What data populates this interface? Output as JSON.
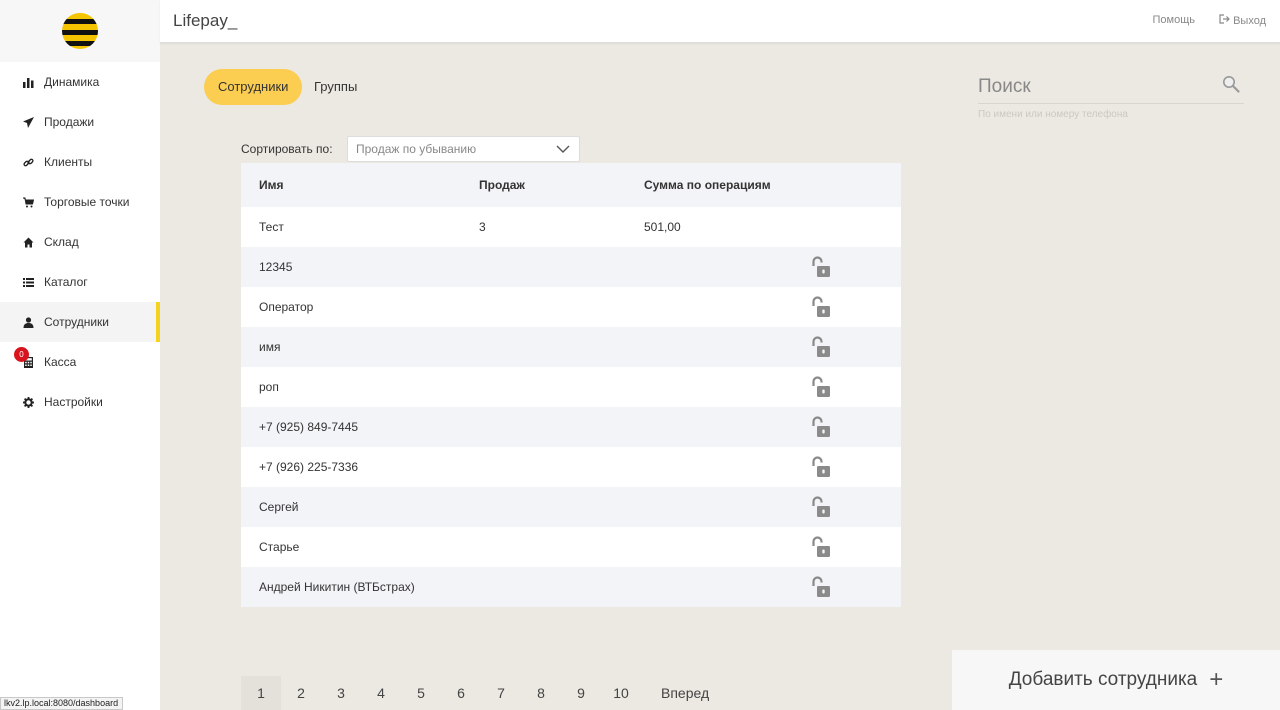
{
  "header": {
    "app_title": "Lifepay_",
    "help": "Помощь",
    "logout": "Выход"
  },
  "sidebar": {
    "items": [
      {
        "label": "Динамика",
        "icon": "bar-chart-icon"
      },
      {
        "label": "Продажи",
        "icon": "paper-plane-icon"
      },
      {
        "label": "Клиенты",
        "icon": "link-icon"
      },
      {
        "label": "Торговые точки",
        "icon": "cart-icon"
      },
      {
        "label": "Склад",
        "icon": "home-icon"
      },
      {
        "label": "Каталог",
        "icon": "list-icon"
      },
      {
        "label": "Сотрудники",
        "icon": "user-icon"
      },
      {
        "label": "Касса",
        "icon": "calculator-icon",
        "badge": "0"
      },
      {
        "label": "Настройки",
        "icon": "gear-icon"
      }
    ],
    "active_index": 6
  },
  "tabs": {
    "employees": "Сотрудники",
    "groups": "Группы"
  },
  "sort": {
    "label": "Сортировать по:",
    "value": "Продаж по убыванию"
  },
  "table": {
    "columns": [
      "Имя",
      "Продаж",
      "Сумма по операциям"
    ],
    "rows": [
      {
        "name": "Тест",
        "sales": "3",
        "sum": "501,00",
        "locked": false
      },
      {
        "name": "12345",
        "sales": "",
        "sum": "",
        "locked": true
      },
      {
        "name": "Оператор",
        "sales": "",
        "sum": "",
        "locked": true
      },
      {
        "name": "имя",
        "sales": "",
        "sum": "",
        "locked": true
      },
      {
        "name": "роп",
        "sales": "",
        "sum": "",
        "locked": true
      },
      {
        "name": "+7 (925) 849-7445",
        "sales": "",
        "sum": "",
        "locked": true
      },
      {
        "name": "+7 (926) 225-7336",
        "sales": "",
        "sum": "",
        "locked": true
      },
      {
        "name": "Сергей",
        "sales": "",
        "sum": "",
        "locked": true
      },
      {
        "name": "Старье",
        "sales": "",
        "sum": "",
        "locked": true
      },
      {
        "name": "Андрей Никитин (ВТБстрах)",
        "sales": "",
        "sum": "",
        "locked": true
      }
    ]
  },
  "search": {
    "placeholder": "Поиск",
    "hint": "По имени или номеру телефона"
  },
  "pagination": {
    "pages": [
      "1",
      "2",
      "3",
      "4",
      "5",
      "6",
      "7",
      "8",
      "9",
      "10"
    ],
    "current": "1",
    "next": "Вперед"
  },
  "add_employee": {
    "label": "Добавить сотрудника",
    "plus": "+"
  },
  "statusbar": {
    "url": "lkv2.lp.local:8080/dashboard"
  },
  "colors": {
    "accent": "#fbcd50",
    "active_marker": "#f6d220",
    "badge": "#d9141d",
    "background": "#ece9e3"
  }
}
